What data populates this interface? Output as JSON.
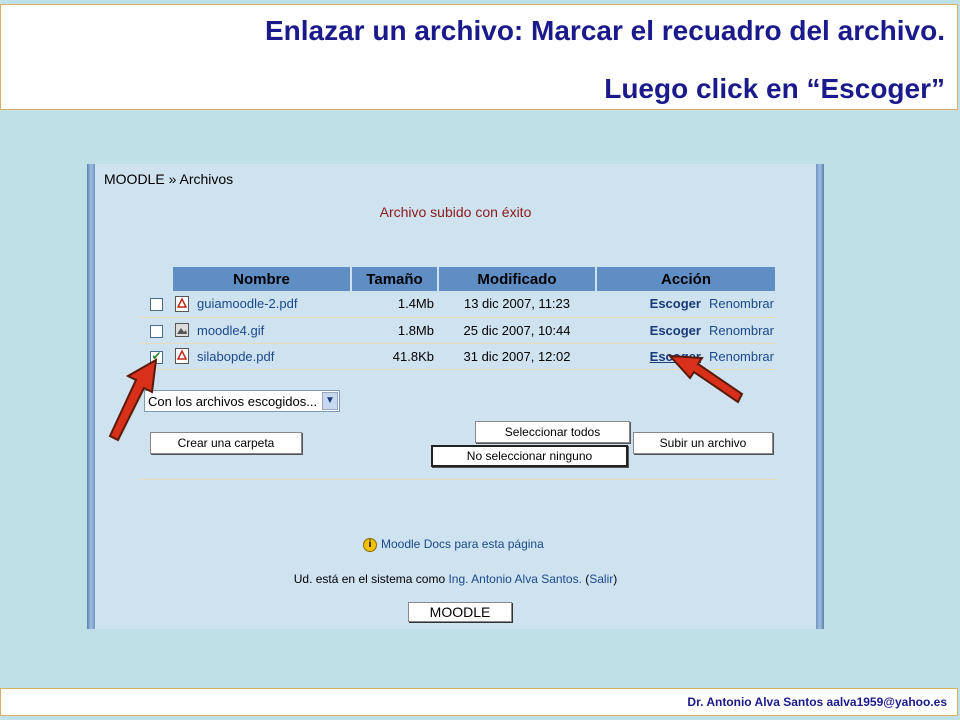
{
  "slide": {
    "title_line1": "Enlazar un archivo: Marcar el recuadro del archivo.",
    "title_line2": "Luego click en “Escoger”",
    "footer": "Dr. Antonio Alva Santos  aalva1959@yahoo.es"
  },
  "moodle": {
    "breadcrumb_root": "MOODLE",
    "breadcrumb_sep": " » ",
    "breadcrumb_current": "Archivos",
    "success_message": "Archivo subido con éxito",
    "table": {
      "headers": [
        "Nombre",
        "Tamaño",
        "Modificado",
        "Acción"
      ],
      "rows": [
        {
          "name": "guiamoodle-2.pdf",
          "size": "1.4Mb",
          "modified": "13 dic 2007, 11:23",
          "action1": "Escoger",
          "action2": "Renombrar",
          "checked": false,
          "icon": "pdf-file-icon"
        },
        {
          "name": "moodle4.gif",
          "size": "1.8Mb",
          "modified": "25 dic 2007, 10:44",
          "action1": "Escoger",
          "action2": "Renombrar",
          "checked": false,
          "icon": "image-file-icon"
        },
        {
          "name": "silabopde.pdf",
          "size": "41.8Kb",
          "modified": "31 dic 2007, 12:02",
          "action1": "Escoger",
          "action2": "Renombrar",
          "checked": true,
          "icon": "pdf-file-icon"
        }
      ]
    },
    "bulk_select_value": "Con los archivos escogidos...",
    "buttons": {
      "create_folder": "Crear una carpeta",
      "select_all": "Seleccionar todos",
      "select_none": "No seleccionar ninguno",
      "upload": "Subir un archivo"
    },
    "docs_link": "Moodle Docs para esta página",
    "logged_in_prefix": "Ud. está en el sistema como ",
    "logged_in_user": "Ing. Antonio Alva Santos.",
    "logout_open": " (",
    "logout_label": "Salir",
    "logout_close": ")",
    "home_button": "MOODLE"
  },
  "colors": {
    "title": "#1a1a8c",
    "header_bg": "#5f8ec4",
    "arrow": "#d8301a",
    "success": "#8b1a1a"
  }
}
